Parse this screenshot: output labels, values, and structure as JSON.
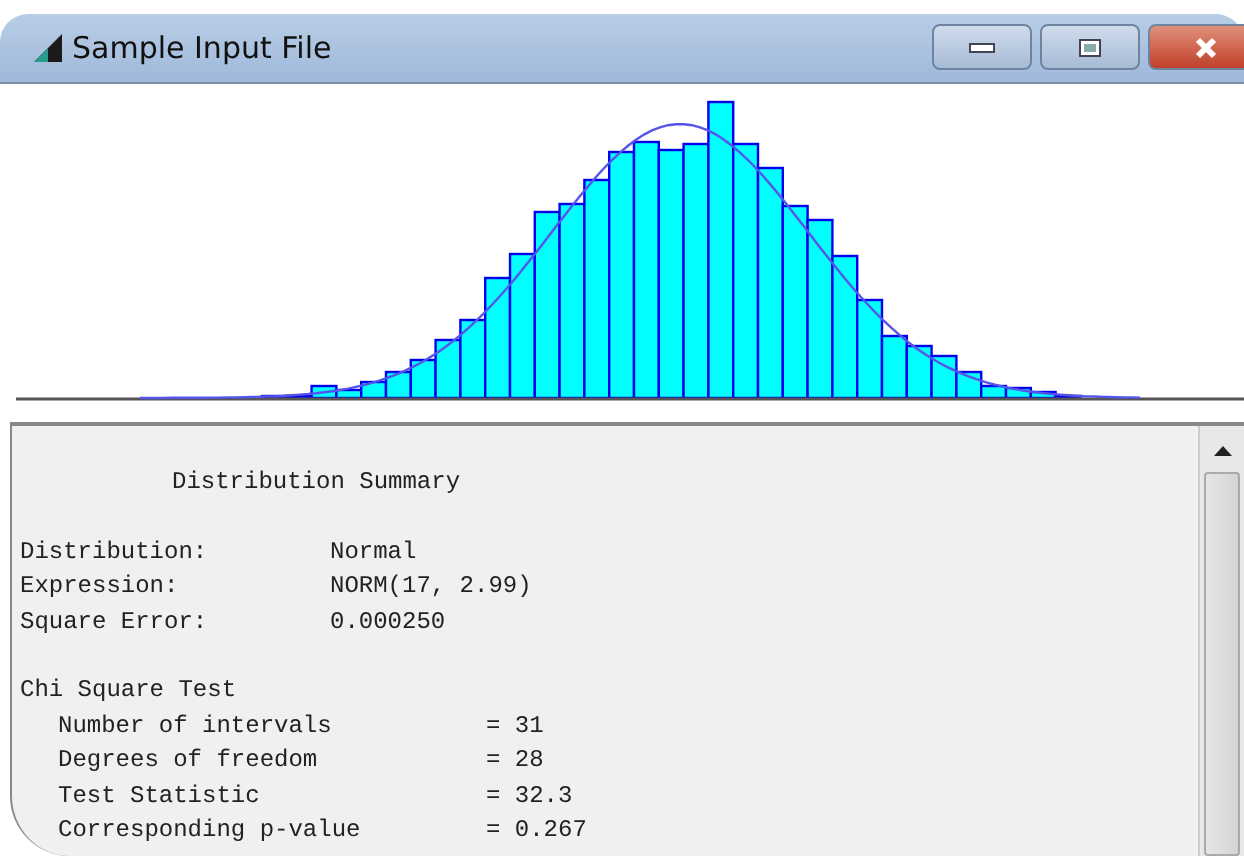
{
  "window": {
    "title": "Sample Input File"
  },
  "summary": {
    "heading": "Distribution Summary",
    "fields": [
      {
        "label": "Distribution:",
        "value": "Normal"
      },
      {
        "label": "Expression:",
        "value": "NORM(17, 2.99)"
      },
      {
        "label": "Square Error:",
        "value": "0.000250"
      }
    ],
    "test": {
      "heading": "Chi Square Test",
      "items": [
        {
          "label": "Number of intervals",
          "value": "= 31"
        },
        {
          "label": "Degrees of freedom",
          "value": "= 28"
        },
        {
          "label": "Test Statistic",
          "value": "= 32.3"
        },
        {
          "label": "Corresponding p-value",
          "value": "= 0.267"
        }
      ]
    }
  }
}
